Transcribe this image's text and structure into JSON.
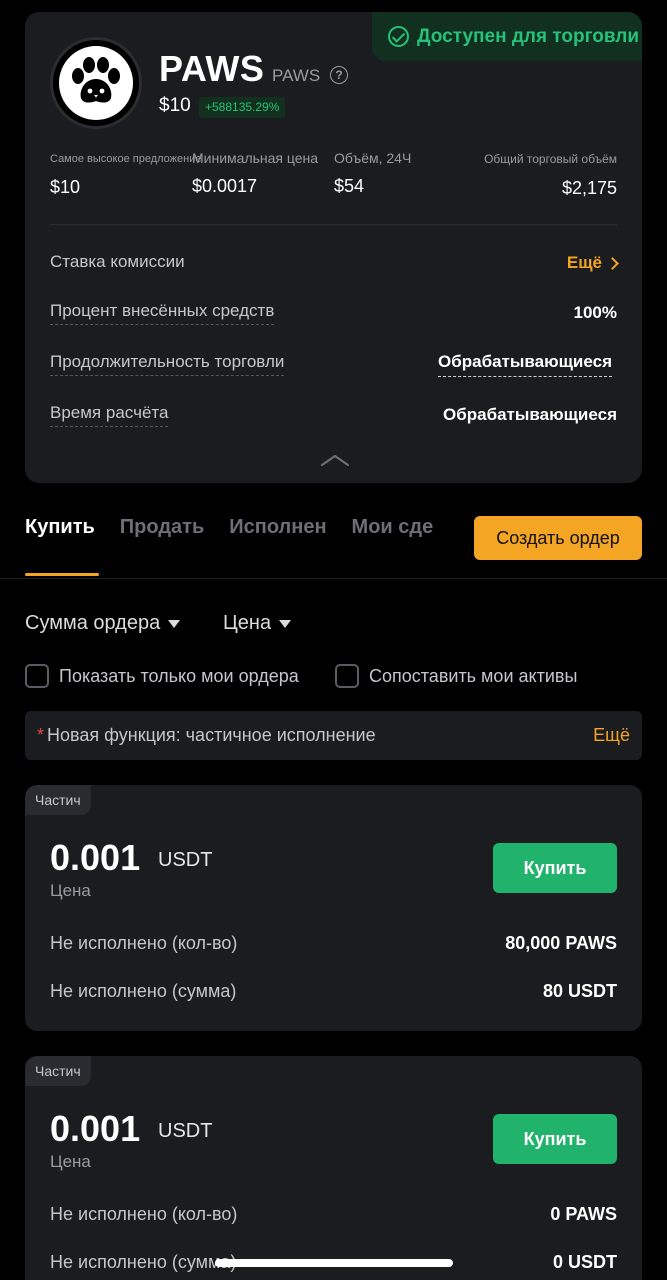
{
  "status": {
    "label": "Доступен для торговли"
  },
  "token": {
    "name": "PAWS",
    "symbol": "PAWS",
    "price": "$10",
    "change": "+588135.29%"
  },
  "stats": [
    {
      "label": "Самое высокое предложение",
      "value": "$10"
    },
    {
      "label": "Минимальная цена",
      "value": "$0.0017"
    },
    {
      "label": "Объём, 24Ч",
      "value": "$54"
    },
    {
      "label": "Общий торговый объём",
      "value": "$2,175"
    }
  ],
  "details": {
    "fee_label": "Ставка комиссии",
    "fee_more": "Ещё",
    "deposit_label": "Процент внесённых средств",
    "deposit_value": "100%",
    "duration_label": "Продолжительность торговли",
    "duration_value": "Обрабатывающиеся",
    "settle_label": "Время расчёта",
    "settle_value": "Обрабатывающиеся"
  },
  "tabs": [
    "Купить",
    "Продать",
    "Исполнен",
    "Мои сде"
  ],
  "create_order": "Создать ордер",
  "filters": {
    "amount": "Сумма ордера",
    "price": "Цена"
  },
  "checks": {
    "my_orders": "Показать только мои ордера",
    "my_assets": "Сопоставить мои активы"
  },
  "notice": {
    "star": "*",
    "text": "Новая функция: частичное исполнение",
    "more": "Ещё"
  },
  "orders": [
    {
      "badge": "Частич",
      "price": "0.001",
      "unit": "USDT",
      "price_label": "Цена",
      "buy": "Купить",
      "qty_label": "Не исполнено (кол-во)",
      "qty_value": "80,000 PAWS",
      "sum_label": "Не исполнено (сумма)",
      "sum_value": "80 USDT"
    },
    {
      "badge": "Частич",
      "price": "0.001",
      "unit": "USDT",
      "price_label": "Цена",
      "buy": "Купить",
      "qty_label": "Не исполнено (кол-во)",
      "qty_value": "0 PAWS",
      "sum_label": "Не исполнено (сумма)",
      "sum_value": "0 USDT"
    }
  ],
  "colors": {
    "accent": "#f5a524",
    "success": "#26c27a",
    "buy": "#21b26b",
    "card": "#1b1c20"
  }
}
